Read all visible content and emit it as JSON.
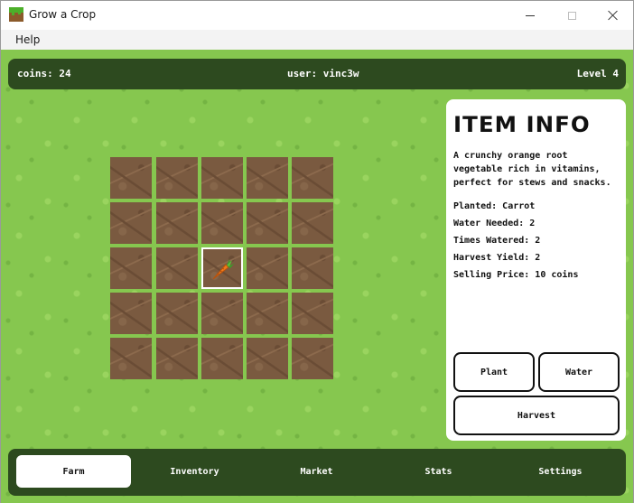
{
  "window": {
    "title": "Grow a Crop"
  },
  "menu": {
    "items": [
      "Help"
    ]
  },
  "status": {
    "coins": "coins: 24",
    "user": "user: vinc3w",
    "level": "Level 4"
  },
  "farm": {
    "rows": 5,
    "cols": 5,
    "selected_plot": {
      "row": 3,
      "col": 3
    },
    "planted": [
      {
        "row": 3,
        "col": 3,
        "crop": "carrot-icon"
      }
    ]
  },
  "item_info": {
    "title": "ITEM INFO",
    "description": "A crunchy orange root vegetable rich in vitamins, perfect for stews and snacks.",
    "planted": "Planted: Carrot",
    "water_needed": "Water Needed: 2",
    "times_watered": "Times Watered: 2",
    "harvest_yield": "Harvest Yield: 2",
    "selling_price": "Selling Price: 10 coins"
  },
  "actions": {
    "plant": "Plant",
    "water": "Water",
    "harvest": "Harvest"
  },
  "nav": {
    "tabs": [
      {
        "label": "Farm",
        "active": true
      },
      {
        "label": "Inventory",
        "active": false
      },
      {
        "label": "Market",
        "active": false
      },
      {
        "label": "Stats",
        "active": false
      },
      {
        "label": "Settings",
        "active": false
      }
    ]
  },
  "colors": {
    "grass": "#86c74f",
    "bar": "#2d4a1f",
    "soil": "#7a5a40"
  }
}
